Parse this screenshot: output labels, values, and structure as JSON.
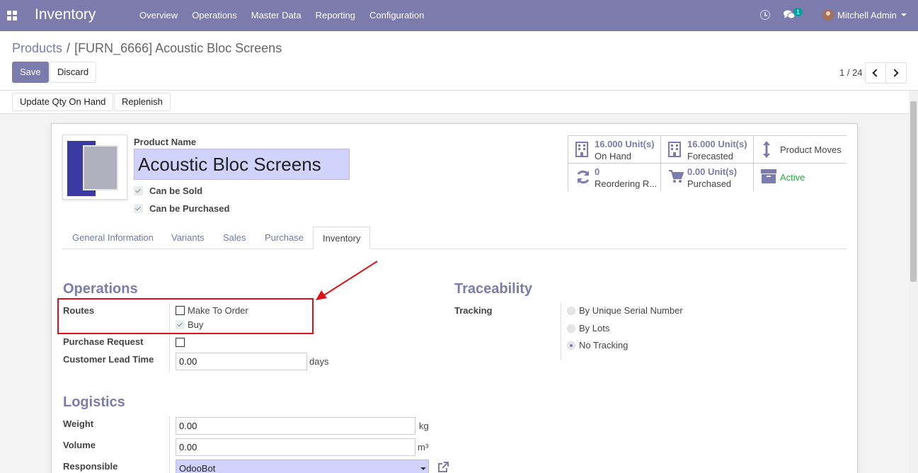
{
  "navbar": {
    "brand": "Inventory",
    "menu": [
      "Overview",
      "Operations",
      "Master Data",
      "Reporting",
      "Configuration"
    ],
    "chat_count": "1",
    "user": "Mitchell Admin"
  },
  "breadcrumb": {
    "parent": "Products",
    "separator": "/",
    "current": "[FURN_6666] Acoustic Bloc Screens"
  },
  "toolbar": {
    "save_label": "Save",
    "discard_label": "Discard",
    "pager": "1 / 24"
  },
  "statusbar": {
    "update_qty_label": "Update Qty On Hand",
    "replenish_label": "Replenish"
  },
  "product": {
    "name_label": "Product Name",
    "name": "Acoustic Bloc Screens",
    "can_be_sold_label": "Can be Sold",
    "can_be_sold": true,
    "can_be_purchased_label": "Can be Purchased",
    "can_be_purchased": true
  },
  "smart_buttons": {
    "on_hand": {
      "value": "16.000",
      "unit": "Unit(s)",
      "label": "On Hand",
      "icon": "building-icon"
    },
    "forecasted": {
      "value": "16.000",
      "unit": "Unit(s)",
      "label": "Forecasted",
      "icon": "building-icon"
    },
    "product_moves": {
      "label": "Product Moves",
      "icon": "arrows-v-icon"
    },
    "reordering": {
      "value": "0",
      "label": "Reordering R...",
      "icon": "refresh-icon"
    },
    "purchased": {
      "value": "0.00",
      "unit": "Unit(s)",
      "label": "Purchased",
      "icon": "cart-icon"
    },
    "active": {
      "label": "Active",
      "icon": "archive-icon",
      "color": "#28a745"
    }
  },
  "tabs": [
    "General Information",
    "Variants",
    "Sales",
    "Purchase",
    "Inventory"
  ],
  "active_tab": "Inventory",
  "operations": {
    "title": "Operations",
    "routes_label": "Routes",
    "routes": [
      {
        "label": "Make To Order",
        "checked": false
      },
      {
        "label": "Buy",
        "checked": true
      }
    ],
    "purchase_request_label": "Purchase Request",
    "purchase_request": false,
    "customer_lead_time_label": "Customer Lead Time",
    "customer_lead_time": "0.00",
    "customer_lead_time_unit": "days"
  },
  "traceability": {
    "title": "Traceability",
    "tracking_label": "Tracking",
    "options": [
      {
        "label": "By Unique Serial Number",
        "selected": false
      },
      {
        "label": "By Lots",
        "selected": false
      },
      {
        "label": "No Tracking",
        "selected": true
      }
    ]
  },
  "logistics": {
    "title": "Logistics",
    "weight_label": "Weight",
    "weight": "0.00",
    "weight_unit": "kg",
    "volume_label": "Volume",
    "volume": "0.00",
    "volume_unit": "m³",
    "responsible_label": "Responsible",
    "responsible": "OdooBot"
  },
  "colors": {
    "brand": "#7c7bad",
    "annotation": "#e0101a"
  }
}
